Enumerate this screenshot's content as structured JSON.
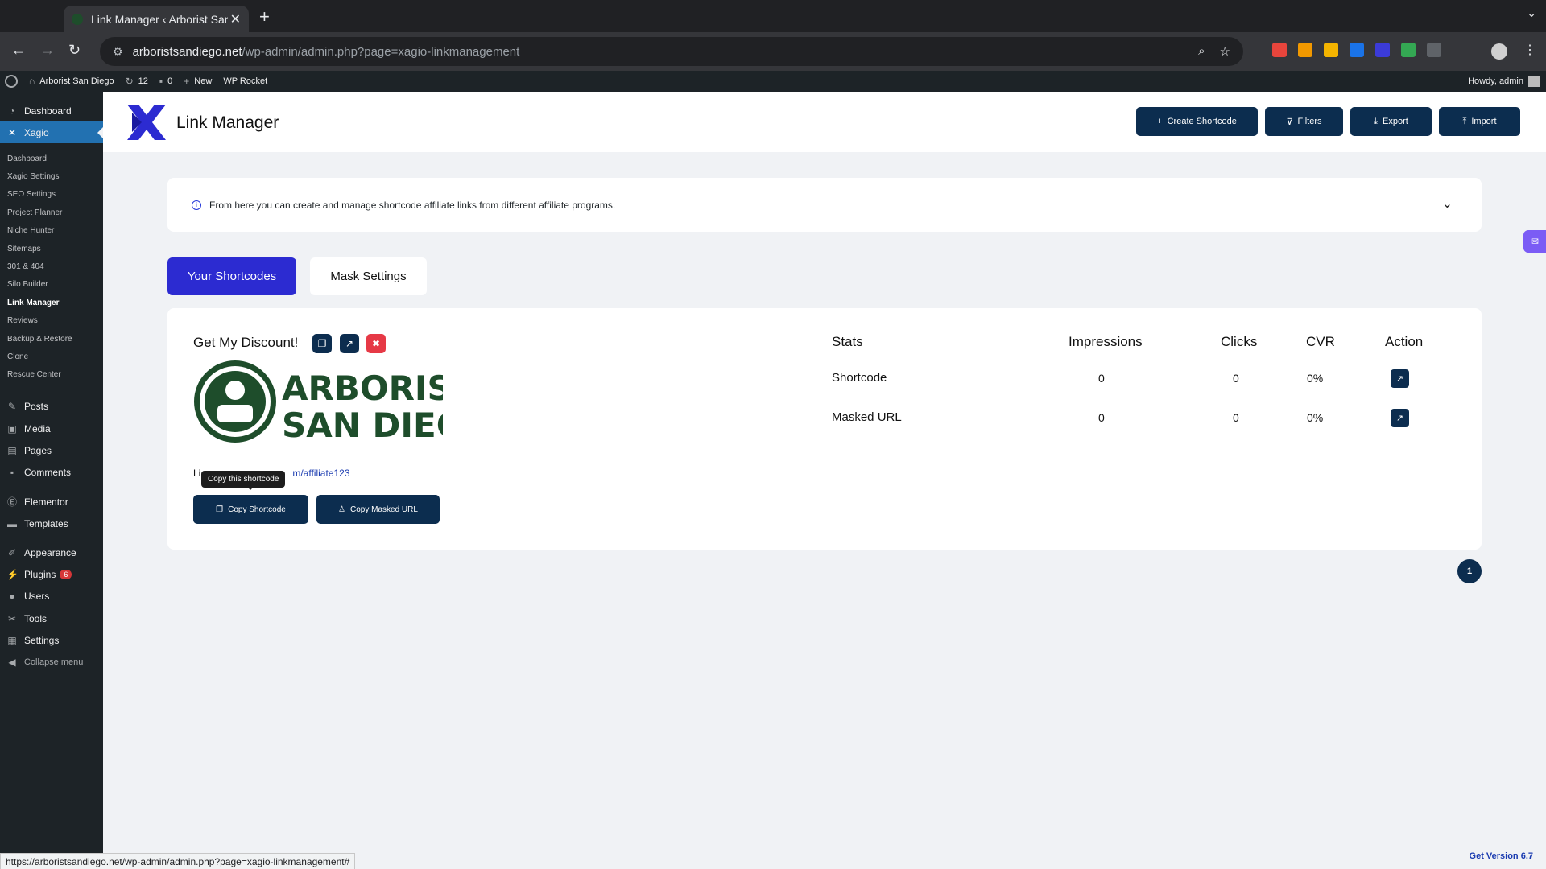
{
  "browser": {
    "tab_title": "Link Manager ‹ Arborist San D",
    "tab_close": "✕",
    "new_tab": "+",
    "tab_menu": "⌄",
    "url_host": "arboristsandiego.net",
    "url_path": "/wp-admin/admin.php?page=xagio-linkmanagement",
    "status_url": "https://arboristsandiego.net/wp-admin/admin.php?page=xagio-linkmanagement#"
  },
  "adminbar": {
    "site_name": "Arborist San Diego",
    "updates": "12",
    "comments": "0",
    "new_label": "New",
    "wp_rocket": "WP Rocket",
    "howdy": "Howdy, admin"
  },
  "sidebar": {
    "top_items": [
      {
        "label": "Dashboard",
        "icon": "dashboard-icon"
      },
      {
        "label": "Xagio",
        "icon": "xagio-icon"
      }
    ],
    "submenu": [
      "Dashboard",
      "Xagio Settings",
      "SEO Settings",
      "Project Planner",
      "Niche Hunter",
      "Sitemaps",
      "301 & 404",
      "Silo Builder",
      "Link Manager",
      "Reviews",
      "Backup & Restore",
      "Clone",
      "Rescue Center"
    ],
    "bottom_items": [
      {
        "label": "Posts"
      },
      {
        "label": "Media"
      },
      {
        "label": "Pages"
      },
      {
        "label": "Comments"
      },
      {
        "label": "Elementor"
      },
      {
        "label": "Templates"
      },
      {
        "label": "Appearance"
      },
      {
        "label": "Plugins",
        "badge": "6"
      },
      {
        "label": "Users"
      },
      {
        "label": "Tools"
      },
      {
        "label": "Settings"
      },
      {
        "label": "Collapse menu"
      }
    ]
  },
  "header": {
    "title": "Link Manager",
    "buttons": {
      "create": "Create Shortcode",
      "filters": "Filters",
      "export": "Export",
      "import": "Import"
    }
  },
  "info": {
    "text": "From here you can create and manage shortcode affiliate links from different affiliate programs."
  },
  "tabs": {
    "shortcodes": "Your Shortcodes",
    "mask": "Mask Settings"
  },
  "card": {
    "title": "Get My Discount!",
    "brand_line1": "ARBORIST",
    "brand_line2": "SAN DIEGO",
    "link_prefix": "Li",
    "link_suffix": "m/affiliate123",
    "tooltip": "Copy this shortcode",
    "copy_shortcode": "Copy Shortcode",
    "copy_masked": "Copy Masked URL"
  },
  "stats": {
    "headers": {
      "stats": "Stats",
      "impressions": "Impressions",
      "clicks": "Clicks",
      "cvr": "CVR",
      "action": "Action"
    },
    "rows": [
      {
        "label": "Shortcode",
        "impressions": "0",
        "clicks": "0",
        "cvr": "0%"
      },
      {
        "label": "Masked URL",
        "impressions": "0",
        "clicks": "0",
        "cvr": "0%"
      }
    ]
  },
  "pagination": {
    "current": "1"
  },
  "footer": {
    "version": "Get Version 6.7"
  },
  "colors": {
    "primary": "#2c2bd1",
    "navy": "#0c2d4f",
    "danger": "#e63946",
    "wp_blue": "#2271b1"
  }
}
